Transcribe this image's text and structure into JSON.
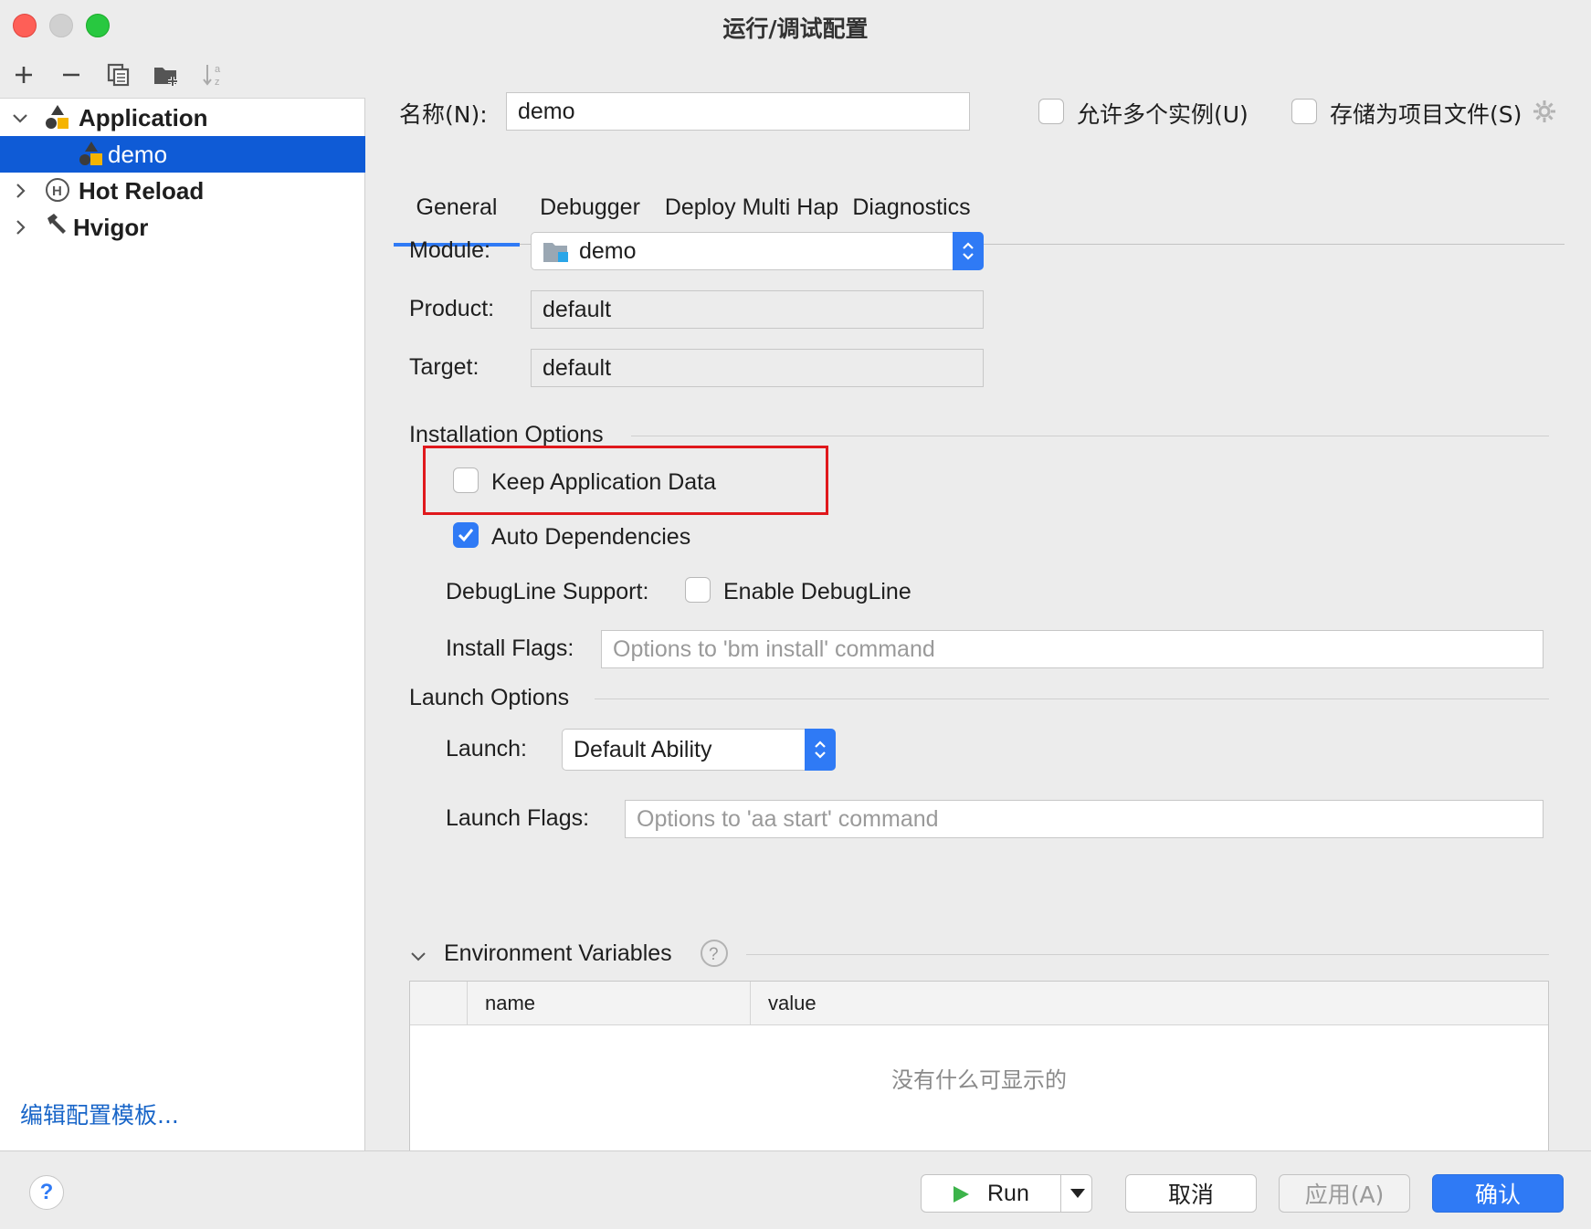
{
  "window": {
    "title": "运行/调试配置"
  },
  "tree": {
    "items": [
      {
        "label": "Application",
        "icon": "application-icon",
        "expanded": true
      },
      {
        "label": "demo",
        "icon": "app-config-icon",
        "selected": true
      },
      {
        "label": "Hot Reload",
        "icon": "hot-reload-icon",
        "expanded": false
      },
      {
        "label": "Hvigor",
        "icon": "hammer-icon",
        "expanded": false
      }
    ],
    "edit_templates_link": "编辑配置模板..."
  },
  "header": {
    "name_label": "名称(N):",
    "name_value": "demo",
    "allow_multiple_label": "允许多个实例(U)",
    "allow_multiple_checked": false,
    "store_as_project_label": "存储为项目文件(S)",
    "store_as_project_checked": false
  },
  "tabs": [
    {
      "label": "General",
      "active": true
    },
    {
      "label": "Debugger",
      "active": false
    },
    {
      "label": "Deploy Multi Hap",
      "active": false
    },
    {
      "label": "Diagnostics",
      "active": false
    }
  ],
  "general": {
    "module_label": "Module:",
    "module_value": "demo",
    "product_label": "Product:",
    "product_value": "default",
    "target_label": "Target:",
    "target_value": "default",
    "installation_title": "Installation Options",
    "keep_app_data_label": "Keep Application Data",
    "keep_app_data_checked": false,
    "auto_deps_label": "Auto Dependencies",
    "auto_deps_checked": true,
    "debugline_label": "DebugLine Support:",
    "enable_debugline_label": "Enable DebugLine",
    "enable_debugline_checked": false,
    "install_flags_label": "Install Flags:",
    "install_flags_placeholder": "Options to 'bm install' command",
    "launch_title": "Launch Options",
    "launch_label": "Launch:",
    "launch_value": "Default Ability",
    "launch_flags_label": "Launch Flags:",
    "launch_flags_placeholder": "Options to 'aa start' command",
    "env_title": "Environment Variables",
    "env_columns": [
      "name",
      "value"
    ],
    "env_empty": "没有什么可显示的"
  },
  "footer": {
    "help": "?",
    "run_label": "Run",
    "cancel_label": "取消",
    "apply_label": "应用(A)",
    "ok_label": "确认"
  },
  "colors": {
    "accent": "#2f7af5",
    "selection": "#0f5bd6",
    "highlight_box": "#e0181c",
    "link": "#1865c8"
  }
}
